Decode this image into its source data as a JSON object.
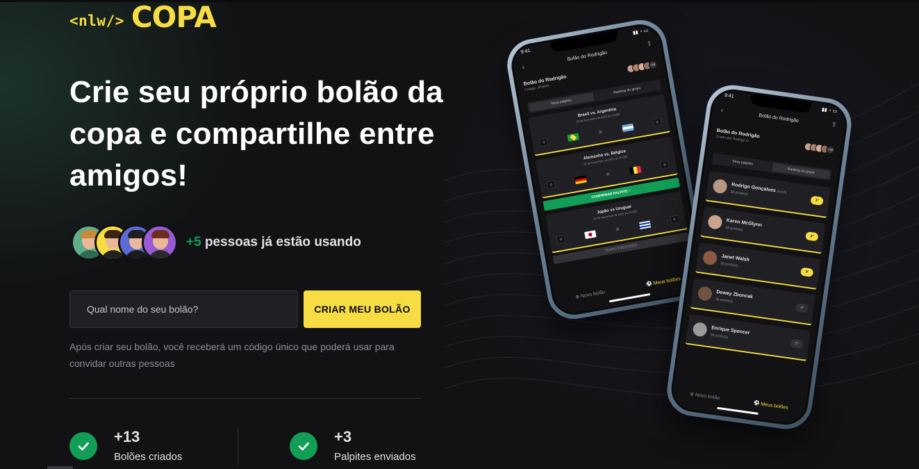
{
  "brand": {
    "tag": "<nlw/>",
    "name": "COPA"
  },
  "hero": {
    "headline": "Crie seu próprio bolão da copa e compartilhe entre amigos!",
    "users_count": "+5",
    "users_text": "pessoas já estão usando"
  },
  "form": {
    "input_placeholder": "Qual nome do seu bolão?",
    "submit_label": "CRIAR MEU BOLÃO",
    "description": "Após criar seu bolão, você receberá um código único que poderá usar para convidar outras pessoas"
  },
  "stats": [
    {
      "value": "+13",
      "label": "Bolões criados"
    },
    {
      "value": "+3",
      "label": "Palpites enviados"
    }
  ],
  "phone_back": {
    "time": "9:41",
    "title": "Bolão do Rodrigão",
    "group_name": "Bolão do Rodrigão",
    "group_code": "Código: JP3640",
    "more_count": "+16",
    "tabs": [
      "Seus palpites",
      "Ranking do grupo"
    ],
    "matches": [
      {
        "title": "Brasil vs. Argentina",
        "date": "22 de Novembro de 2022 às 16:00h",
        "score_a": "3",
        "score_b": "0"
      },
      {
        "title": "Alemanha vs. Bélgica",
        "date": "22 de Novembro de 2022 às 19:00h",
        "score_a": "0",
        "score_b": "0"
      },
      {
        "title": "Japão vs Uruguai",
        "date": "20 de Novembro de 2022 às 13:00h",
        "score_a": "0",
        "score_b": "0"
      }
    ],
    "confirm_label": "CONFIRMAR PALPITE ✓",
    "expired_label": "TEMPO ESGOTADO",
    "nav": [
      "Novo bolão",
      "Meus bolões"
    ]
  },
  "phone_front": {
    "time": "9:41",
    "title": "Bolão do Rodrigão",
    "group_name": "Bolão do Rodrigão",
    "group_sub": "Criado por Rodrigo G.",
    "more_count": "+16",
    "tabs": [
      "Seus palpites",
      "Ranking do grupo"
    ],
    "ranking": [
      {
        "name": "Rodrigo Gonçalves",
        "note": "(você)",
        "points": "36 ponto(s)",
        "pos": "1º",
        "top": true
      },
      {
        "name": "Karen McGlynn",
        "note": "",
        "points": "36 ponto(s)",
        "pos": "2º",
        "top": true
      },
      {
        "name": "Janet Walsh",
        "note": "",
        "points": "36 ponto(s)",
        "pos": "3º",
        "top": true
      },
      {
        "name": "Dewey Zboncak",
        "note": "",
        "points": "36 ponto(s)",
        "pos": "4º",
        "top": false
      },
      {
        "name": "Enrique Spencer",
        "note": "",
        "points": "36 ponto(s)",
        "pos": "5º",
        "top": false
      }
    ],
    "nav": [
      "Novo bolão",
      "Meus bolões"
    ]
  },
  "colors": {
    "accent": "#F7DD43",
    "success": "#129E57",
    "background": "#121214"
  }
}
